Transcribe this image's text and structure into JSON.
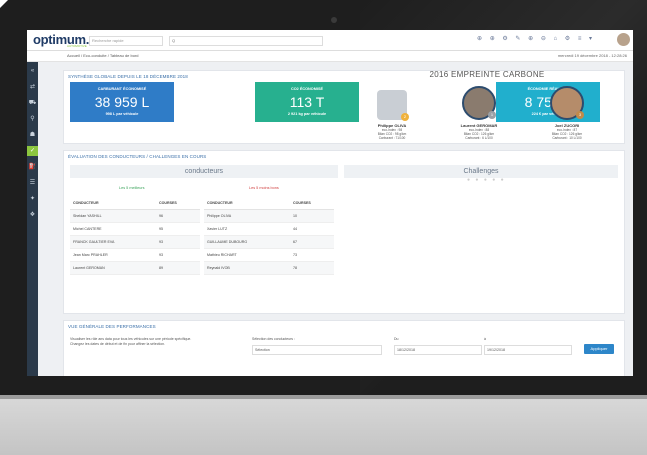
{
  "app": {
    "logo": "optimum.",
    "logo_sub": "AUTOMOTIVE",
    "search_placeholder": "Recherche rapide",
    "select_value": "Q",
    "top_icons": "⊕ ⊕ ⚙ ✎ ⊕ ⊖ ⌂ ⚙ ≡ ▾",
    "breadcrumb": "Accueil  /  Eco-conduite  /  Tableau de bord",
    "date": "mercredi 19 décembre 2018 - 12:28:26"
  },
  "sidebar": {
    "icons": [
      "«",
      "⇄",
      "⛟",
      "⚲",
      "☗",
      "✓",
      "⛽",
      "☰",
      "✦",
      "❖"
    ]
  },
  "synthese": {
    "title": "SYNTHÈSE GLOBALE DEPUIS LE 18 DÉCEMBRE 2018",
    "kpis": [
      {
        "label": "CARBURANT ÉCONOMISÉ",
        "value": "38 959 L",
        "sub": "998 L par véhicule",
        "color": "#2f7cc7"
      },
      {
        "label": "CO2 ÉCONOMISÉ",
        "value": "113 T",
        "sub": "2 921 kg par véhicule",
        "color": "#27b08f"
      },
      {
        "label": "ÉCONOMIE RÉALISÉE",
        "value": "8 757 €",
        "sub": "224 € par véhicule",
        "color": "#21afcd"
      }
    ]
  },
  "evaluation": {
    "title": "ÉVALUATION DES CONDUCTEURS / CHALLENGES EN COURS",
    "conducteurs_label": "conducteurs",
    "challenges_label": "Challenges",
    "best_caption": "Les 5 meilleurs",
    "worst_caption": "Les 5 moins bons",
    "col_driver": "CONDUCTEUR",
    "col_courses": "COURSES",
    "best": [
      {
        "name": "Sheldan YASHILL",
        "courses": "96"
      },
      {
        "name": "Michel CANTERE",
        "courses": "95"
      },
      {
        "name": "FRANCK GAULTIER EVA",
        "courses": "93"
      },
      {
        "name": "Jean Marc PRAHLER",
        "courses": "93"
      },
      {
        "name": "Laurent GEROMAN",
        "courses": "89"
      }
    ],
    "worst": [
      {
        "name": "Philippe OLIVA",
        "courses": "10"
      },
      {
        "name": "Xavier LUTZ",
        "courses": "44"
      },
      {
        "name": "GUILLAUME DUBOURG",
        "courses": "67"
      },
      {
        "name": "Mathieu RICHART",
        "courses": "73"
      },
      {
        "name": "Reynald IVOB",
        "courses": "78"
      }
    ],
    "carbon_title": "2016 EMPREINTE CARBONE",
    "podium": [
      {
        "name": "Philippe OLIVA",
        "l1": "eco-Index : 98",
        "l2": "Bilan CO2 : 98 g/km",
        "l3": "Carburant : 71/100",
        "medal": "2"
      },
      {
        "name": "Laurent GEROMAR",
        "l1": "eco-Index : 88",
        "l2": "Bilan CO2 : 126 g/km",
        "l3": "Carburant : 6 L/100",
        "medal": "1"
      },
      {
        "name": "Joel ZUCORI",
        "l1": "eco-Index : 87",
        "l2": "Bilan CO2 : 126 g/km",
        "l3": "Carburant : 10 L/100",
        "medal": "3"
      }
    ],
    "carousel_dots": "● ● ● ● ●"
  },
  "performance": {
    "title": "VUE GÉNÉRALE DES PERFORMANCES",
    "help_1": "Visualiser les rôle ans data pour tous les véhicules sur une période spécifique.",
    "help_2": "Changez les dates de début et de fin pour affiner la sélection.",
    "select_label": "Sélection des conducteurs :",
    "select_value": "Sélection",
    "from_label": "Du",
    "from_value": "18/12/2018",
    "to_label": "à",
    "to_value": "19/12/2018",
    "apply": "Appliquer"
  }
}
